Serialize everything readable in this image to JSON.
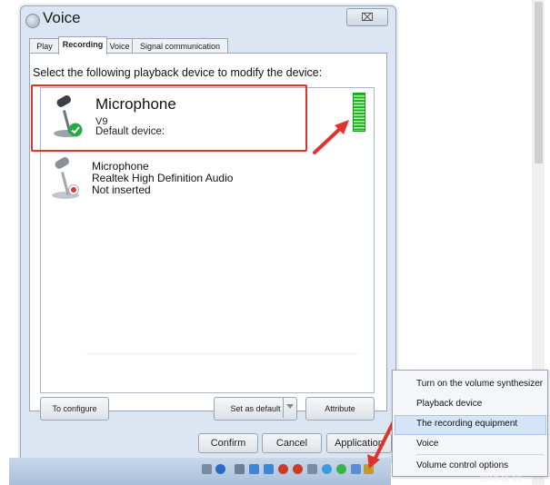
{
  "dialog": {
    "title": "Voice",
    "close_glyph": "⌧",
    "tabs": [
      "Play",
      "Recording",
      "Voice",
      "Signal communication"
    ],
    "instruction": "Select the following playback device to modify the device:",
    "devices": [
      {
        "name": "Microphone",
        "subtitle": "V9",
        "status": "Default device:",
        "icon": "microphone-icon",
        "badge": "check-badge-icon"
      },
      {
        "name": "Microphone",
        "driver": "Realtek High Definition Audio",
        "status": "Not inserted",
        "icon": "microphone-icon",
        "badge": "unplugged-badge-icon"
      }
    ],
    "buttons": {
      "configure": "To configure",
      "set_default": "Set as default",
      "attribute": "Attribute",
      "confirm": "Confirm",
      "cancel": "Cancel",
      "application": "Application"
    }
  },
  "context_menu": {
    "items": [
      "Turn on the volume synthesizer",
      "Playback device",
      "The recording equipment",
      "Voice",
      "Volume control options"
    ],
    "highlighted": "The recording equipment"
  },
  "taskbar": {
    "clock": "2018-11-16"
  },
  "colors": {
    "annotation": "#e0332b",
    "accent": "#d5e4f6",
    "meter": "#1fb51f"
  }
}
